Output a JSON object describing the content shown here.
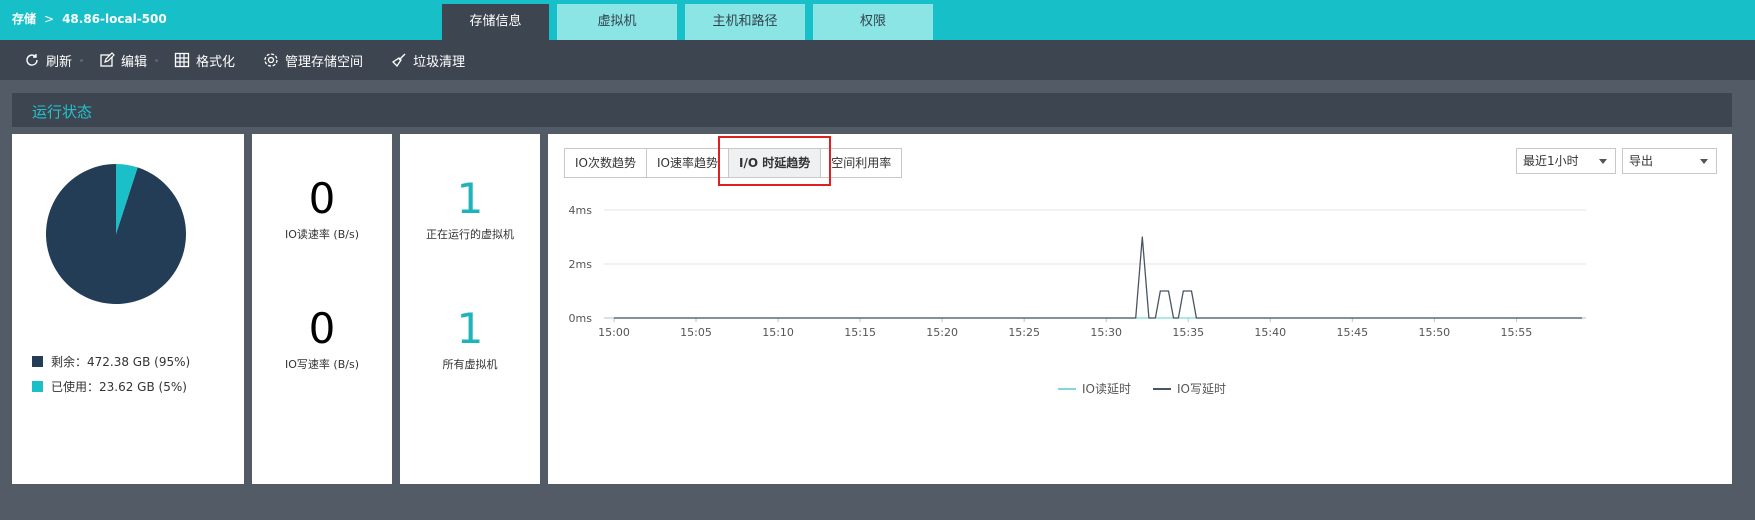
{
  "breadcrumb": {
    "root": "存储",
    "sep": ">",
    "current": "48.86-local-500"
  },
  "tabs": [
    {
      "label": "存储信息",
      "active": true
    },
    {
      "label": "虚拟机",
      "active": false
    },
    {
      "label": "主机和路径",
      "active": false
    },
    {
      "label": "权限",
      "active": false
    }
  ],
  "toolbar": {
    "refresh": "刷新",
    "edit": "编辑",
    "format": "格式化",
    "manage": "管理存储空间",
    "cleanup": "垃圾清理"
  },
  "section": {
    "title": "运行状态"
  },
  "pie": {
    "remaining_label": "剩余：472.38 GB (95%)",
    "used_label": "已使用：23.62 GB (5%)",
    "remaining_fraction": 0.95,
    "used_fraction": 0.05,
    "colors": {
      "remaining": "#233d56",
      "used": "#1bbfc7"
    }
  },
  "io": {
    "read_value": "0",
    "read_label": "IO读速率 (B/s)",
    "write_value": "0",
    "write_label": "IO写速率 (B/s)"
  },
  "vm": {
    "running_value": "1",
    "running_label": "正在运行的虚拟机",
    "all_value": "1",
    "all_label": "所有虚拟机"
  },
  "chart_tabs": [
    {
      "label": "IO次数趋势",
      "active": false
    },
    {
      "label": "IO速率趋势",
      "active": false
    },
    {
      "label": "I/O 时延趋势",
      "active": true
    },
    {
      "label": "空间利用率",
      "active": false
    }
  ],
  "controls": {
    "range": "最近1小时",
    "export": "导出"
  },
  "chart_data": {
    "type": "line",
    "x_ticks": [
      "15:00",
      "15:05",
      "15:10",
      "15:15",
      "15:20",
      "15:25",
      "15:30",
      "15:35",
      "15:40",
      "15:45",
      "15:50",
      "15:55"
    ],
    "y_ticks": [
      "0ms",
      "2ms",
      "4ms"
    ],
    "ylim": [
      0,
      4
    ],
    "xlim_minutes": [
      0,
      59
    ],
    "series": [
      {
        "name": "IO读延时",
        "color": "#7fd9dc",
        "points": [
          [
            0,
            0
          ],
          [
            59,
            0
          ]
        ]
      },
      {
        "name": "IO写延时",
        "color": "#4a5563",
        "points": [
          [
            0,
            0
          ],
          [
            31.8,
            0
          ],
          [
            32.2,
            3
          ],
          [
            32.6,
            0
          ],
          [
            33.0,
            0
          ],
          [
            33.3,
            1
          ],
          [
            33.8,
            1
          ],
          [
            34.1,
            0
          ],
          [
            34.4,
            0
          ],
          [
            34.7,
            1
          ],
          [
            35.2,
            1
          ],
          [
            35.5,
            0
          ],
          [
            59,
            0
          ]
        ]
      }
    ]
  }
}
